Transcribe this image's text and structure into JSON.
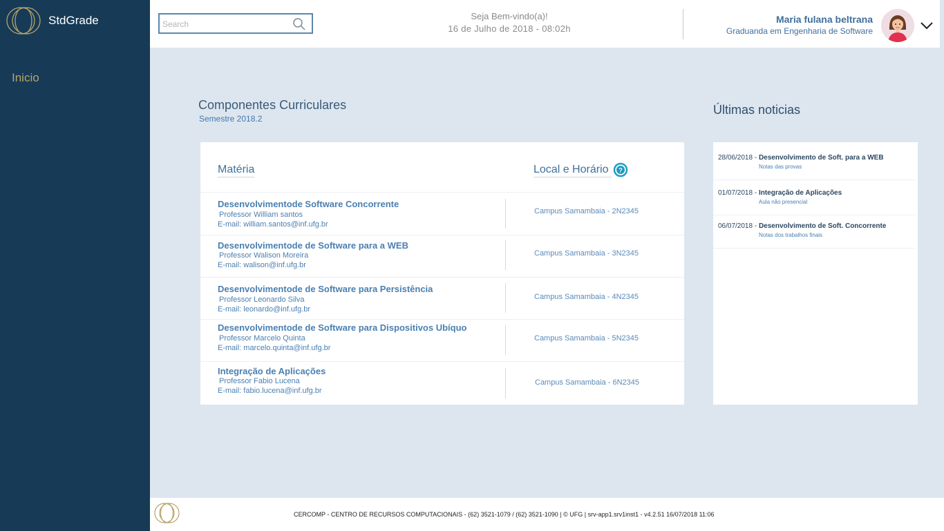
{
  "brand": {
    "name": "StdGrade",
    "logo_icon": "rings-logo-icon"
  },
  "sidebar": {
    "items": [
      {
        "label": "Inicio"
      }
    ]
  },
  "header": {
    "search": {
      "placeholder": "Search",
      "value": ""
    },
    "welcome": "Seja Bem-vindo(a)!",
    "datetime": "16 de Julho de 2018 - 08:02h",
    "user": {
      "name": "Maria fulana beltrana",
      "role": "Graduanda em Engenharia de Software"
    }
  },
  "components": {
    "title": "Componentes Curriculares",
    "semester": "Semestre 2018.2",
    "columns": {
      "materia": "Matéria",
      "local": "Local e Horário"
    },
    "rows": [
      {
        "course": "Desenvolvimentode Software Concorrente",
        "professor": "Professor William santos",
        "email": "E-mail: william.santos@inf.ufg.br",
        "location": "Campus Samambaia - 2N2345"
      },
      {
        "course": "Desenvolvimentode de Software para a WEB",
        "professor": "Professor Walison Moreira",
        "email": "E-mail: walison@inf.ufg.br",
        "location": "Campus Samambaia - 3N2345"
      },
      {
        "course": "Desenvolvimentode de Software para Persistência",
        "professor": "Professor Leonardo Silva",
        "email": "E-mail: leonardo@inf.ufg.br",
        "location": "Campus Samambaia - 4N2345"
      },
      {
        "course": "Desenvolvimentode de Software para Dispositivos Ubíquo",
        "professor": "Professor Marcelo Quinta",
        "email": "E-mail: marcelo.quinta@inf.ufg.br",
        "location": "Campus Samambaia - 5N2345"
      },
      {
        "course": "Integração de Aplicações",
        "professor": "Professor Fabio Lucena",
        "email": "E-mail: fabio.lucena@inf.ufg.br",
        "location": "Campus Samambaia - 6N2345"
      }
    ]
  },
  "news": {
    "title": "Últimas noticias",
    "items": [
      {
        "date": "28/06/2018 -",
        "headline": "Desenvolvimento de Soft. para  a WEB",
        "desc": "Notas das provas"
      },
      {
        "date": "01/07/2018 -",
        "headline": "Integração de Aplicações",
        "desc": "Aula não presencial"
      },
      {
        "date": "06/07/2018 -",
        "headline": "Desenvolvimento de Soft. Concorrente",
        "desc": "Notas dos trabalhos finais"
      }
    ]
  },
  "footer": {
    "text": "CERCOMP - CENTRO DE RECURSOS COMPUTACIONAIS - (62) 3521-1079 / (62) 3521-1090 | © UFG | srv-app1.srv1inst1 - v4.2.51 16/07/2018 11:06"
  },
  "colors": {
    "sidebar": "#173a56",
    "accent": "#3f6f9c",
    "nav_gold": "#b8a56a",
    "background": "#dde6ef"
  }
}
